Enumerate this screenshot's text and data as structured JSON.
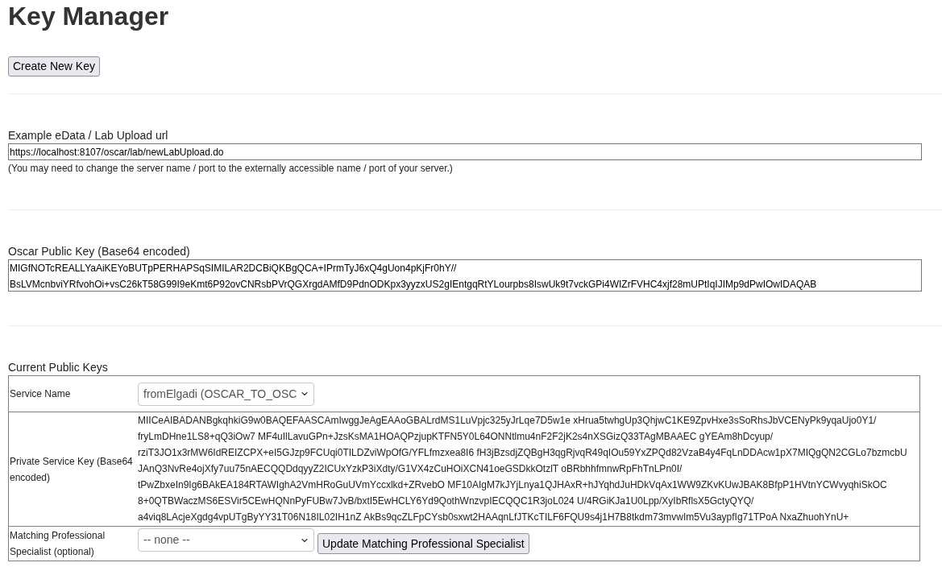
{
  "title": "Key Manager",
  "create_button": "Create New Key",
  "upload_url": {
    "label": "Example eData / Lab Upload url",
    "value": "https://localhost:8107/oscar/lab/newLabUpload.do",
    "note": "(You may need to change the server name / port to the externally accessible name / port of your server.)"
  },
  "public_key": {
    "label": "Oscar Public Key (Base64 encoded)",
    "lines": [
      "MIGfNOTcREALLYaAiKEYoBUTpPERHAPSqSIMILAR2DCBiQKBgQCA+IPrmTyJ6xQ4gUon4pKjFr0hY//",
      "BsLVMcnbviYRfvohOi+vsC26kT58G99I9eKmt6P92ovCNRsbPVrQGXrgdAMfD9PdnODKpx3yyzxUS2gIEntgqRtYLourpbs8IswUk9t7vckGPi4WIZrFVHC4xjf28mUPtIqIJIMp9dPwIOwIDAQAB"
    ]
  },
  "current_keys": {
    "heading": "Current Public Keys",
    "rows": [
      {
        "kind": "select",
        "label": "Service Name",
        "value": "fromElgadi (OSCAR_TO_OSC"
      },
      {
        "kind": "key_text",
        "label": "Private Service Key (Base64 encoded)",
        "lines": [
          "MIICeAIBADANBgkqhkiG9w0BAQEFAASCAmIwggJeAgEAAoGBALrdMS1LuVpjc325yJrLqe7D5w1e xHrua5twhgUp3QhjwC1KE9ZpvHxe3sSoRhsJbVCENyPk9yqaUjo0Y1/",
          "fryLmDHne1LS8+qQ3iOw7 MF4uIlLavuGPn+JzsKsMA1HOAQPzjupKTFN5Y0L64ONNtlmu4nF2F2jK2s4nXSGizQ33TAgMBAAEC gYEAm8hDcyup/",
          "rziT3JO1x3rMW6IdREIZCPX+eI5GJzp9FCUqi0TILDZviWpOfG/YFLfmzxea8I6 fH3jBzsdjZQBgH3qgRjvqR49qIOu59YxZPQd82VzaB4y4FqLnDDAcw1pX7MIQgQN2CGLo7bzmcbU",
          "JAnQ3NvRe4ojXfy7uu75nAECQQDdqyyZ2ICUxYzkP3iXdty/G1VX4zCuHOiXCN41oeGSDkkOtzlT oBRbhhfmnwRpFhTnLPn0I/",
          "tPwZbxeIn9Ig6BAkEA184RTAWIghA2VmHRoGuUVmYccxlkd+ZRvebO MF10AIgM7kJYjLnya1QJHAxR+hJYqhdJuHDkVqAx1WW9ZKvKUwJBAK8BfpP1HVtnYCWvyqhiSkOC",
          "8+0QTBWaczMS6ESVir5CEwHQNnPyFUBw7JvB/bxtI5EwHCLY6Yd9QothWnzvpIECQQC1R3joL024 U/4RGiKJa1U0Lpp/XyIbRflsX5GctyQYQ/",
          "a4viq8LAcjeXgdg4vpUTgByYY31T06N18IL02IH1nZ AkBs9qcZLFpCYsb0sxwt2HAAqnLfJTKcTILF6FQU9s4j1H7B8tkdm73mvwIm5Vu3aypfIg71TPoA NxaZhuohYnU+"
        ]
      },
      {
        "kind": "select_with_button",
        "label": "Matching Professional Specialist (optional)",
        "value": "-- none --",
        "button": "Update Matching Professional Specialist"
      }
    ]
  }
}
